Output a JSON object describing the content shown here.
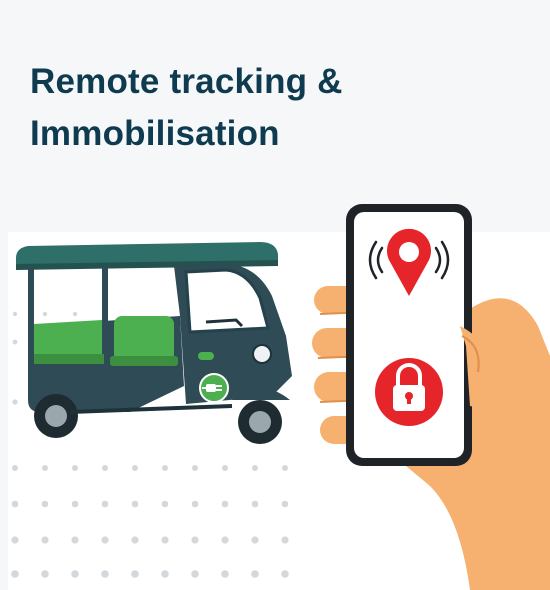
{
  "heading": {
    "line1": "Remote tracking &",
    "line2": "Immobilisation"
  },
  "colors": {
    "heading_text": "#0e3b4f",
    "background": "#f5f7f9",
    "vehicle_body": "#2f4b56",
    "vehicle_roof": "#2f6f6a",
    "seat_green": "#4caf50",
    "alert_red": "#e5252a",
    "skin": "#f6b06f"
  },
  "icons": {
    "location": "map-pin-icon",
    "signal": "signal-waves-icon",
    "lock": "padlock-icon",
    "ev_badge": "ev-plug-icon"
  }
}
